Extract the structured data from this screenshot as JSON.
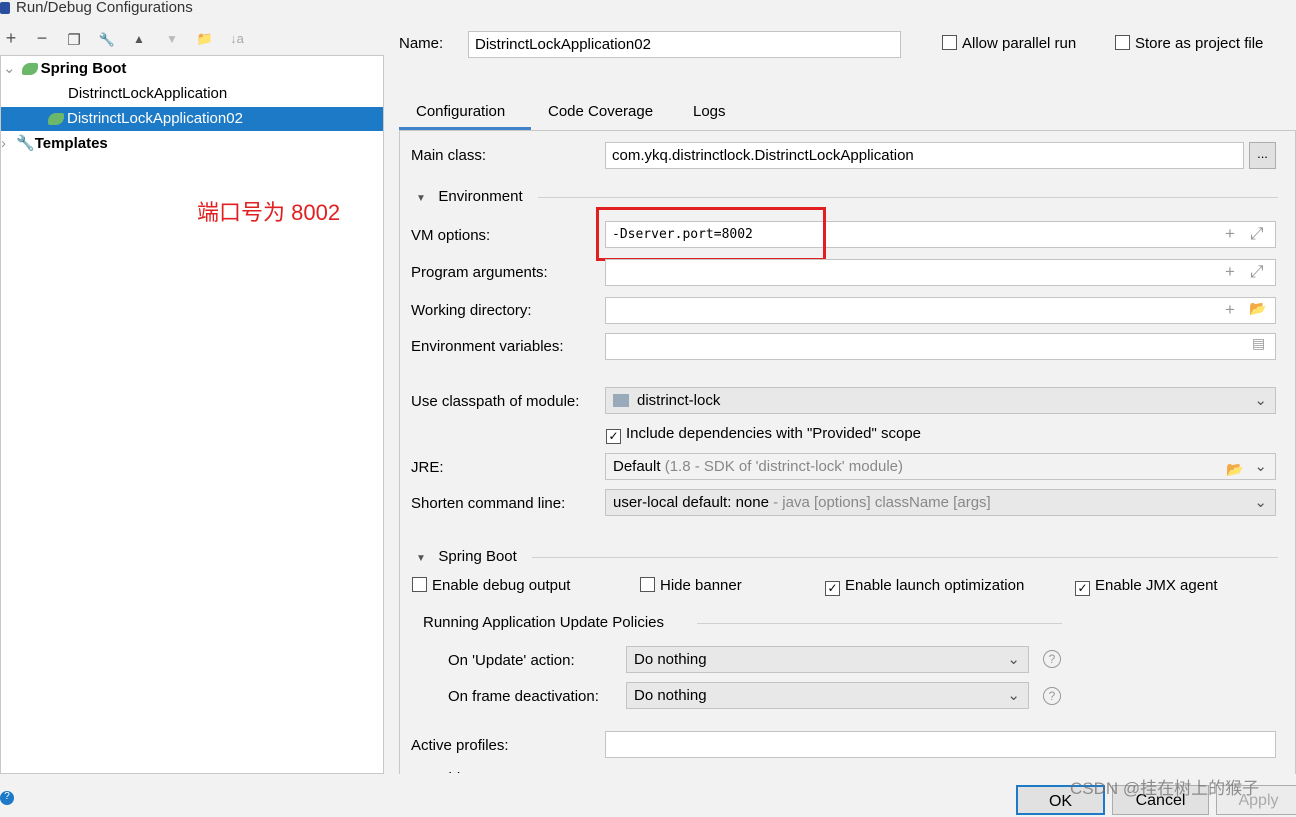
{
  "window": {
    "title": "Run/Debug Configurations"
  },
  "toolbar": {
    "add": "+",
    "remove": "−",
    "copy": "❐",
    "edit": "🔧",
    "up": "▲",
    "down": "▼",
    "folder": "📁",
    "sort": "↓a"
  },
  "tree": {
    "group": "Spring Boot",
    "items": [
      "DistrinctLockApplication",
      "DistrinctLockApplication02"
    ],
    "templates": "Templates"
  },
  "annotation": "端口号为 8002",
  "header": {
    "name_label": "Name:",
    "name_value": "DistrinctLockApplication02",
    "parallel": "Allow parallel run",
    "store": "Store as project file"
  },
  "tabs": [
    "Configuration",
    "Code Coverage",
    "Logs"
  ],
  "config": {
    "main_class_label": "Main class:",
    "main_class": "com.ykq.distrinctlock.DistrinctLockApplication",
    "browse": "...",
    "env_section": "Environment",
    "vm_label": "VM options:",
    "vm_value": "-Dserver.port=8002",
    "prog_label": "Program arguments:",
    "wd_label": "Working directory:",
    "env_label": "Environment variables:",
    "module_label": "Use classpath of module:",
    "module_value": "distrinct-lock",
    "include_deps": "Include dependencies with \"Provided\" scope",
    "jre_label": "JRE:",
    "jre_default": "Default",
    "jre_detail": "(1.8 - SDK of 'distrinct-lock' module)",
    "shorten_label": "Shorten command line:",
    "shorten_value": "user-local default: none",
    "shorten_detail": "- java [options] className [args]",
    "sb_section": "Spring Boot",
    "debug_output": "Enable debug output",
    "hide_banner": "Hide banner",
    "launch_opt": "Enable launch optimization",
    "jmx": "Enable JMX agent",
    "policies": "Running Application Update Policies",
    "update_label": "On 'Update' action:",
    "update_value": "Do nothing",
    "frame_label": "On frame deactivation:",
    "frame_value": "Do nothing",
    "profiles_label": "Active profiles:",
    "override_label": "Override parameters"
  },
  "buttons": {
    "ok": "OK",
    "cancel": "Cancel",
    "apply": "Apply"
  },
  "watermark": "CSDN @挂在树上的猴子"
}
